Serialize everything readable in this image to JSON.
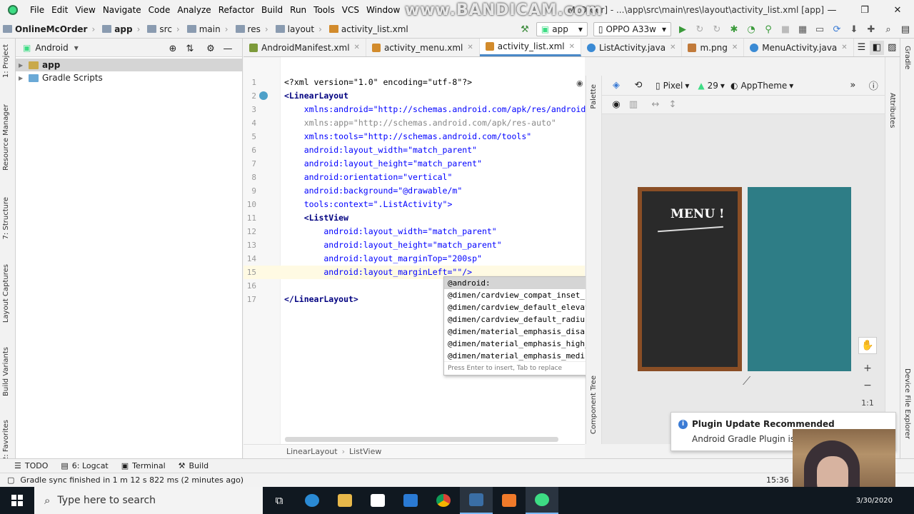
{
  "menubar": {
    "items": [
      "File",
      "Edit",
      "View",
      "Navigate",
      "Code",
      "Analyze",
      "Refactor",
      "Build",
      "Run",
      "Tools",
      "VCS",
      "Window"
    ],
    "title": "McOrder] - ...\\app\\src\\main\\res\\layout\\activity_list.xml [app]",
    "watermark": "www.BANDICAM.com"
  },
  "breadcrumbs": [
    "OnlineMcOrder",
    "app",
    "src",
    "main",
    "res",
    "layout",
    "activity_list.xml"
  ],
  "toolbar": {
    "module": "app",
    "device": "OPPO A33w"
  },
  "left_tabs": [
    "1: Project",
    "Resource Manager",
    "7: Structure",
    "Layout Captures",
    "Build Variants",
    "2: Favorites"
  ],
  "right_tabs": [
    "Gradle",
    "Device File Explorer"
  ],
  "project": {
    "view": "Android",
    "tree": [
      {
        "label": "app",
        "selected": true
      },
      {
        "label": "Gradle Scripts",
        "selected": false
      }
    ]
  },
  "tabs": [
    {
      "label": "AndroidManifest.xml",
      "color": "#7c9a3a",
      "active": false
    },
    {
      "label": "activity_menu.xml",
      "color": "#d28b2c",
      "active": false
    },
    {
      "label": "activity_list.xml",
      "color": "#d28b2c",
      "active": true
    },
    {
      "label": "ListActivity.java",
      "color": "#3a8ad4",
      "active": false
    },
    {
      "label": "m.png",
      "color": "#c17a3a",
      "active": false
    },
    {
      "label": "MenuActivity.java",
      "color": "#3a8ad4",
      "active": false
    }
  ],
  "code": {
    "lines": [
      "<?xml version=\"1.0\" encoding=\"utf-8\"?>",
      "<LinearLayout",
      "    xmlns:android=\"http://schemas.android.com/apk/res/android\"",
      "    xmlns:app=\"http://schemas.android.com/apk/res-auto\"",
      "    xmlns:tools=\"http://schemas.android.com/tools\"",
      "    android:layout_width=\"match_parent\"",
      "    android:layout_height=\"match_parent\"",
      "    android:orientation=\"vertical\"",
      "    android:background=\"@drawable/m\"",
      "    tools:context=\".ListActivity\">",
      "    <ListView",
      "        android:layout_width=\"match_parent\"",
      "        android:layout_height=\"match_parent\"",
      "        android:layout_marginTop=\"200sp\"",
      "        android:layout_marginLeft=\"\"/>",
      "",
      "</LinearLayout>"
    ],
    "line_numbers": [
      "1",
      "2",
      "3",
      "4",
      "5",
      "6",
      "7",
      "8",
      "9",
      "10",
      "11",
      "12",
      "13",
      "14",
      "15",
      "16",
      "17"
    ]
  },
  "autocomplete": {
    "items": [
      "@android:",
      "@dimen/cardview_compat_inset_shadow",
      "@dimen/cardview_default_elevation",
      "@dimen/cardview_default_radius",
      "@dimen/material_emphasis_disabled",
      "@dimen/material_emphasis_high_type",
      "@dimen/material_emphasis_medium"
    ],
    "hint": "Press Enter to insert, Tab to replace"
  },
  "editor_breadcrumb": [
    "LinearLayout",
    "ListView"
  ],
  "design": {
    "device": "Pixel",
    "api": "29",
    "theme": "AppTheme",
    "palette_label": "Palette",
    "component_tree_label": "Component Tree",
    "attributes_label": "Attributes",
    "preview_title": "MENU !",
    "zoom_one": "1:1"
  },
  "notification": {
    "title": "Plugin Update Recommended",
    "body": "Android Gradle Plugin is read"
  },
  "toolwindows": [
    "TODO",
    "6: Logcat",
    "Terminal",
    "Build"
  ],
  "status": {
    "message": "Gradle sync finished in 1 m 12 s 822 ms (2 minutes ago)",
    "position": "15:36"
  },
  "taskbar": {
    "search_placeholder": "Type here to search",
    "date": "3/30/2020"
  }
}
